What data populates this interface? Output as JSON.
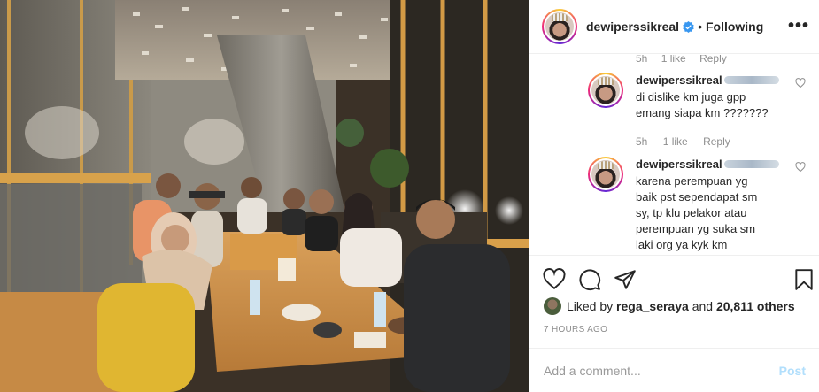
{
  "post": {
    "photo_alt": "",
    "photo_subject": "group-photo"
  },
  "header": {
    "username": "dewiperssikreal",
    "verified_icon": "verified-badge-icon",
    "separator": "•",
    "follow_label": "Following",
    "more_icon": "more-options-icon"
  },
  "comments": {
    "top_meta": {
      "time": "5h",
      "likes": "1 like",
      "reply": "Reply"
    },
    "items": [
      {
        "username": "dewiperssikreal",
        "text": "di dislike km juga gpp\nemang siapa km ???????",
        "time": "5h",
        "likes": "1 like",
        "reply": "Reply"
      },
      {
        "username": "dewiperssikreal",
        "text": "karena perempuan yg\nbaik pst sependapat sm\nsy, tp klu pelakor atau\nperempuan yg suka sm\nlaki org ya kyk km"
      }
    ]
  },
  "actions": {
    "like_icon": "heart-icon",
    "comment_icon": "comment-icon",
    "share_icon": "share-icon",
    "save_icon": "bookmark-icon"
  },
  "likes": {
    "prefix": "Liked by",
    "user": "rega_seraya",
    "joiner": "and",
    "others": "20,811 others"
  },
  "timestamp": "7 HOURS AGO",
  "add_comment": {
    "placeholder": "Add a comment...",
    "post_label": "Post"
  },
  "colors": {
    "link_blue": "#3897f0",
    "post_disabled": "#b2dffc",
    "meta_gray": "#8e8e8e",
    "text": "#262626"
  }
}
